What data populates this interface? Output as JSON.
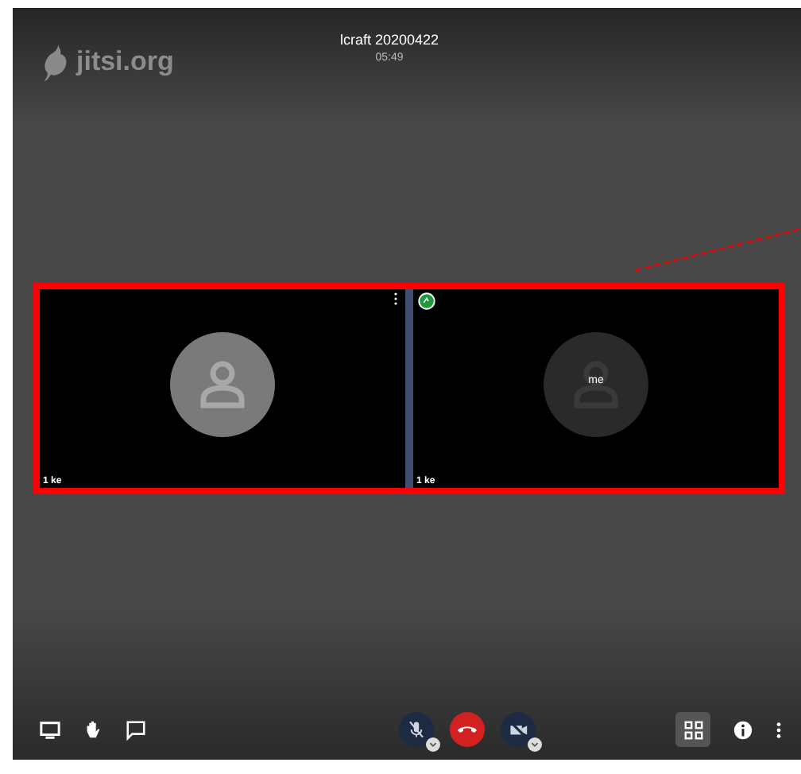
{
  "header": {
    "logo": "jitsi.org",
    "title": "lcraft 20200422",
    "timer": "05:49"
  },
  "tiles": [
    {
      "kind": "remote",
      "name": "1 ke",
      "dominant": false
    },
    {
      "kind": "local",
      "name": "1 ke",
      "avatar_label": "me",
      "dominant": true
    }
  ],
  "toolbar": {
    "mic_muted": true,
    "camera_muted": true,
    "tile_view_selected": true
  }
}
